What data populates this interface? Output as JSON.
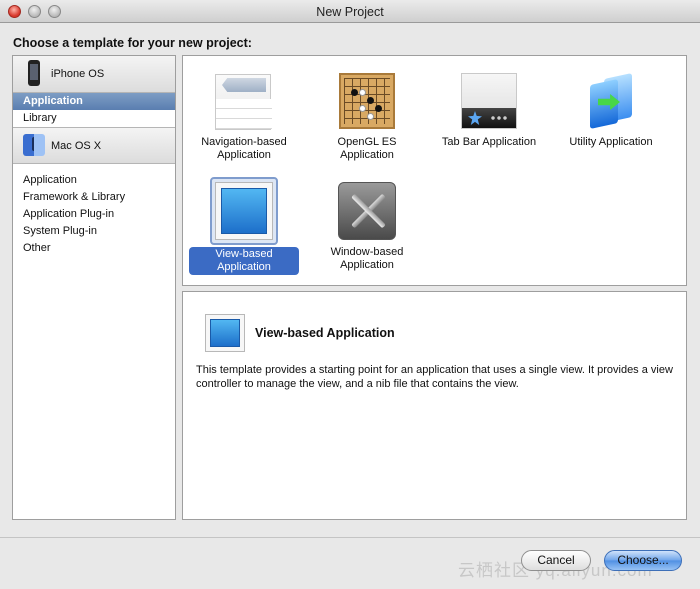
{
  "window": {
    "title": "New Project"
  },
  "heading": "Choose a template for your new project:",
  "sidebar": {
    "groups": [
      {
        "label": "iPhone OS",
        "icon": "iphone-icon",
        "items": [
          "Application",
          "Library"
        ],
        "selected": 0
      },
      {
        "label": "Mac OS X",
        "icon": "finder-icon",
        "items": [
          "Application",
          "Framework & Library",
          "Application Plug-in",
          "System Plug-in",
          "Other"
        ]
      }
    ]
  },
  "templates": [
    {
      "label": "Navigation-based Application",
      "icon": "navigation-template-icon"
    },
    {
      "label": "OpenGL ES Application",
      "icon": "opengl-template-icon"
    },
    {
      "label": "Tab Bar Application",
      "icon": "tab-bar-template-icon"
    },
    {
      "label": "Utility Application",
      "icon": "utility-template-icon"
    },
    {
      "label": "View-based Application",
      "icon": "view-template-icon",
      "selected": true
    },
    {
      "label": "Window-based Application",
      "icon": "window-template-icon"
    }
  ],
  "description": {
    "title": "View-based Application",
    "text": "This template provides a starting point for an application that uses a single view. It provides a view controller to manage the view, and a nib file that contains the view."
  },
  "buttons": {
    "cancel": "Cancel",
    "choose": "Choose..."
  },
  "watermark": "云栖社区 yq.aliyun.com",
  "colors": {
    "selection": "#3b6bc4",
    "sidebar_selection": "#5a7eb0",
    "default_button": "#6ea4ea"
  }
}
